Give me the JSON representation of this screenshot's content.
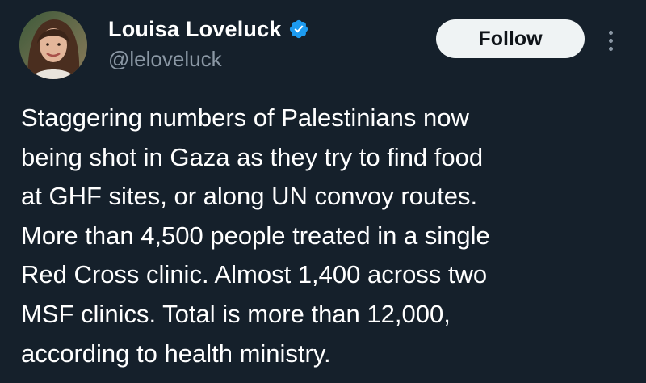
{
  "author": {
    "display_name": "Louisa Loveluck",
    "handle": "@leloveluck",
    "verified_icon": "verified-badge-icon",
    "avatar_icon": "profile-photo"
  },
  "actions": {
    "follow_label": "Follow",
    "more_icon": "more-options-icon"
  },
  "tweet": {
    "lines": [
      "Staggering numbers of Palestinians now",
      "being shot in Gaza as they try to find food",
      "at GHF sites, or along UN convoy routes.",
      "More than 4,500 people treated in a single",
      "Red Cross clinic. Almost 1,400 across two",
      "MSF clinics. Total is more than 12,000,",
      "according to health ministry."
    ]
  },
  "colors": {
    "background": "#15202b",
    "text_primary": "#ffffff",
    "text_secondary": "#8b98a5",
    "verified_blue": "#1d9bf0",
    "follow_bg": "#eff3f4"
  }
}
